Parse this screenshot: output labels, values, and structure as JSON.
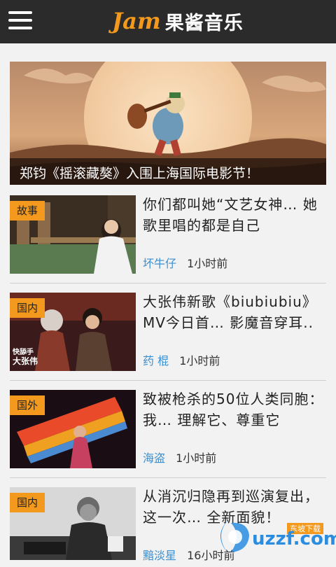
{
  "header": {
    "logo_en": "Jam",
    "logo_cn": "果酱音乐"
  },
  "banner": {
    "caption": "郑钧《摇滚藏獒》入围上海国际电影节！"
  },
  "news": [
    {
      "tag": "故事",
      "title": "你们都叫她“文艺女神… 她歌里唱的都是自己",
      "author": "坏牛仔",
      "time": "1小时前"
    },
    {
      "tag": "国内",
      "title": "大张伟新歌《biubiubiu》MV今日首… 影魔音穿耳..",
      "author": "药 棍",
      "time": "1小时前"
    },
    {
      "tag": "国外",
      "title": "致被枪杀的50位人类同胞：我… 理解它、尊重它",
      "author": "海盗",
      "time": "1小时前"
    },
    {
      "tag": "国内",
      "title": "从消沉归隐再到巡演复出，这一次… 全新面貌！",
      "author": "黯淡星",
      "time": "16小时前"
    }
  ],
  "watermark": {
    "text": "uzzf.com",
    "small": "东坡下载"
  }
}
